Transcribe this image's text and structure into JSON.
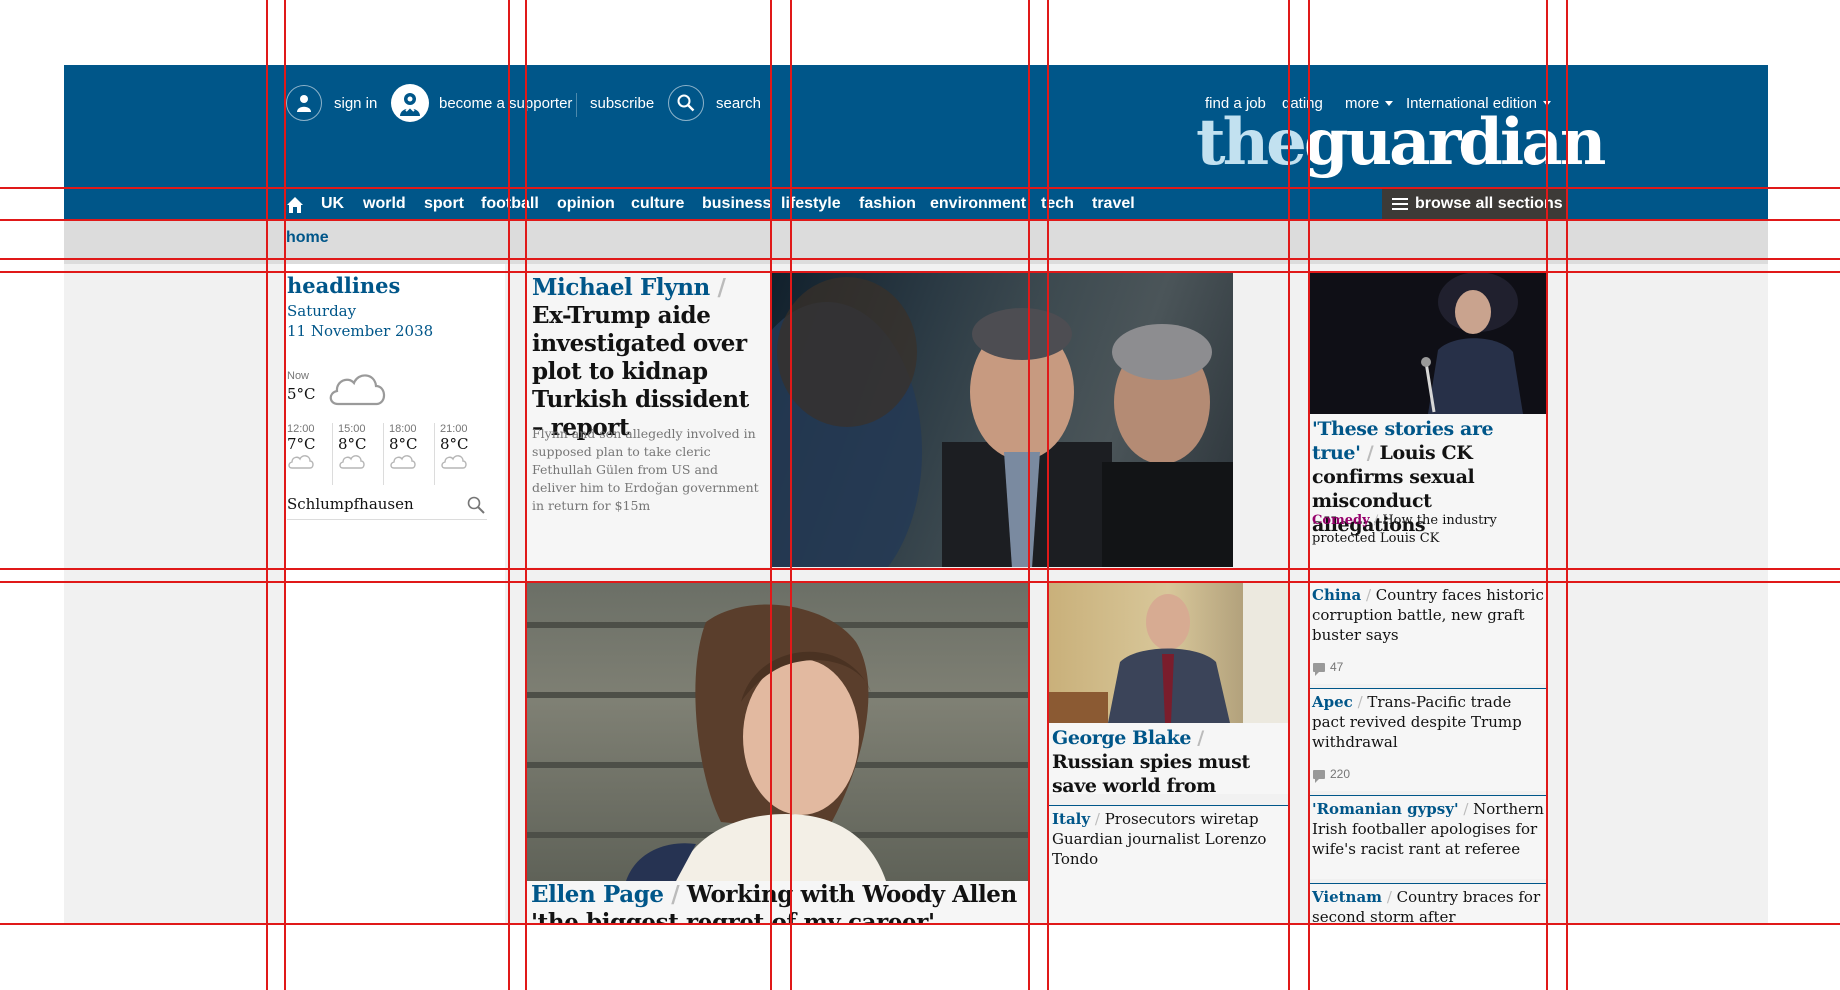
{
  "topbar": {
    "sign_in": "sign in",
    "become_supporter": "become a supporter",
    "subscribe": "subscribe",
    "search": "search",
    "find_job": "find a job",
    "dating": "dating",
    "more": "more",
    "edition": "International edition"
  },
  "logo": {
    "part1": "the",
    "part2": "guardian"
  },
  "nav": {
    "items": [
      "UK",
      "world",
      "sport",
      "football",
      "opinion",
      "culture",
      "business",
      "lifestyle",
      "fashion",
      "environment",
      "tech",
      "travel"
    ],
    "browse": "browse all sections"
  },
  "breadcrumb": {
    "home": "home"
  },
  "headlines": {
    "title": "headlines",
    "day": "Saturday",
    "date": "11 November 2038"
  },
  "weather": {
    "now_label": "Now",
    "now_temp": "5°C",
    "forecast": [
      {
        "time": "12:00",
        "temp": "7°C"
      },
      {
        "time": "15:00",
        "temp": "8°C"
      },
      {
        "time": "18:00",
        "temp": "8°C"
      },
      {
        "time": "21:00",
        "temp": "8°C"
      }
    ],
    "location": "Schlumpfhausen"
  },
  "stories": {
    "flynn": {
      "kicker": "Michael Flynn",
      "headline": "Ex-Trump aide investigated over plot to kidnap Turkish dissident – report",
      "standfirst": "Flynn and son allegedly involved in supposed plan to take cleric Fethullah Gülen from US and deliver him to Erdoğan government in return for $15m"
    },
    "louisck": {
      "kicker": "'These stories are true'",
      "headline": "Louis CK confirms sexual misconduct allegations",
      "sub_kicker": "Comedy",
      "sub_headline": "How the industry protected Louis CK"
    },
    "ellen": {
      "kicker": "Ellen Page",
      "headline": "Working with Woody Allen 'the biggest regret of my career'"
    },
    "blake": {
      "kicker": "George Blake",
      "headline": "Russian spies must save world from nuclear hell"
    },
    "italy": {
      "kicker": "Italy",
      "headline": "Prosecutors wiretap Guardian journalist Lorenzo Tondo"
    },
    "list": [
      {
        "kicker": "China",
        "headline": "Country faces historic corruption battle, new graft buster says",
        "comments": "47"
      },
      {
        "kicker": "Apec",
        "headline": "Trans-Pacific trade pact revived despite Trump withdrawal",
        "comments": "220"
      },
      {
        "kicker": "'Romanian gypsy'",
        "headline": "Northern Irish footballer apologises for wife's racist rant at referee"
      },
      {
        "kicker": "Vietnam",
        "headline": "Country braces for second storm after devastating"
      }
    ]
  },
  "colors": {
    "brand": "#005689",
    "guide": "#e01919",
    "comedy": "#95006b"
  },
  "icons": [
    "user-icon",
    "supporter-icon",
    "search-icon",
    "home-icon",
    "menu-icon",
    "cloud-icon",
    "comment-icon"
  ]
}
